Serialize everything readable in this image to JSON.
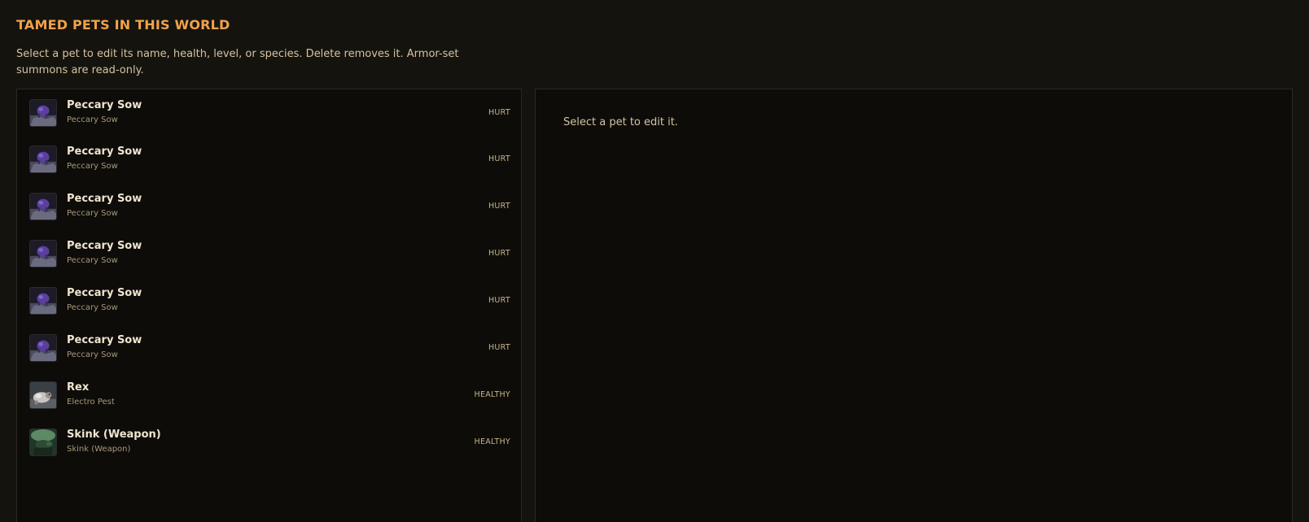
{
  "header": {
    "title": "TAMED PETS IN THIS WORLD",
    "description": "Select a pet to edit its name, health, level, or species. Delete removes it. Armor-set summons are read-only."
  },
  "pets": [
    {
      "name": "Peccary Sow",
      "species": "Peccary Sow",
      "status": "HURT",
      "icon": "peccary-sow-icon"
    },
    {
      "name": "Peccary Sow",
      "species": "Peccary Sow",
      "status": "HURT",
      "icon": "peccary-sow-icon"
    },
    {
      "name": "Peccary Sow",
      "species": "Peccary Sow",
      "status": "HURT",
      "icon": "peccary-sow-icon"
    },
    {
      "name": "Peccary Sow",
      "species": "Peccary Sow",
      "status": "HURT",
      "icon": "peccary-sow-icon"
    },
    {
      "name": "Peccary Sow",
      "species": "Peccary Sow",
      "status": "HURT",
      "icon": "peccary-sow-icon"
    },
    {
      "name": "Peccary Sow",
      "species": "Peccary Sow",
      "status": "HURT",
      "icon": "peccary-sow-icon"
    },
    {
      "name": "Rex",
      "species": "Electro Pest",
      "status": "HEALTHY",
      "icon": "electro-pest-icon"
    },
    {
      "name": "Skink (Weapon)",
      "species": "Skink (Weapon)",
      "status": "HEALTHY",
      "icon": "skink-icon"
    }
  ],
  "editor": {
    "empty_message": "Select a pet to edit it."
  },
  "colors": {
    "background": "#15130e",
    "panel": "#0d0c09",
    "accent": "#f0a24a",
    "text": "#d4c3a2"
  }
}
